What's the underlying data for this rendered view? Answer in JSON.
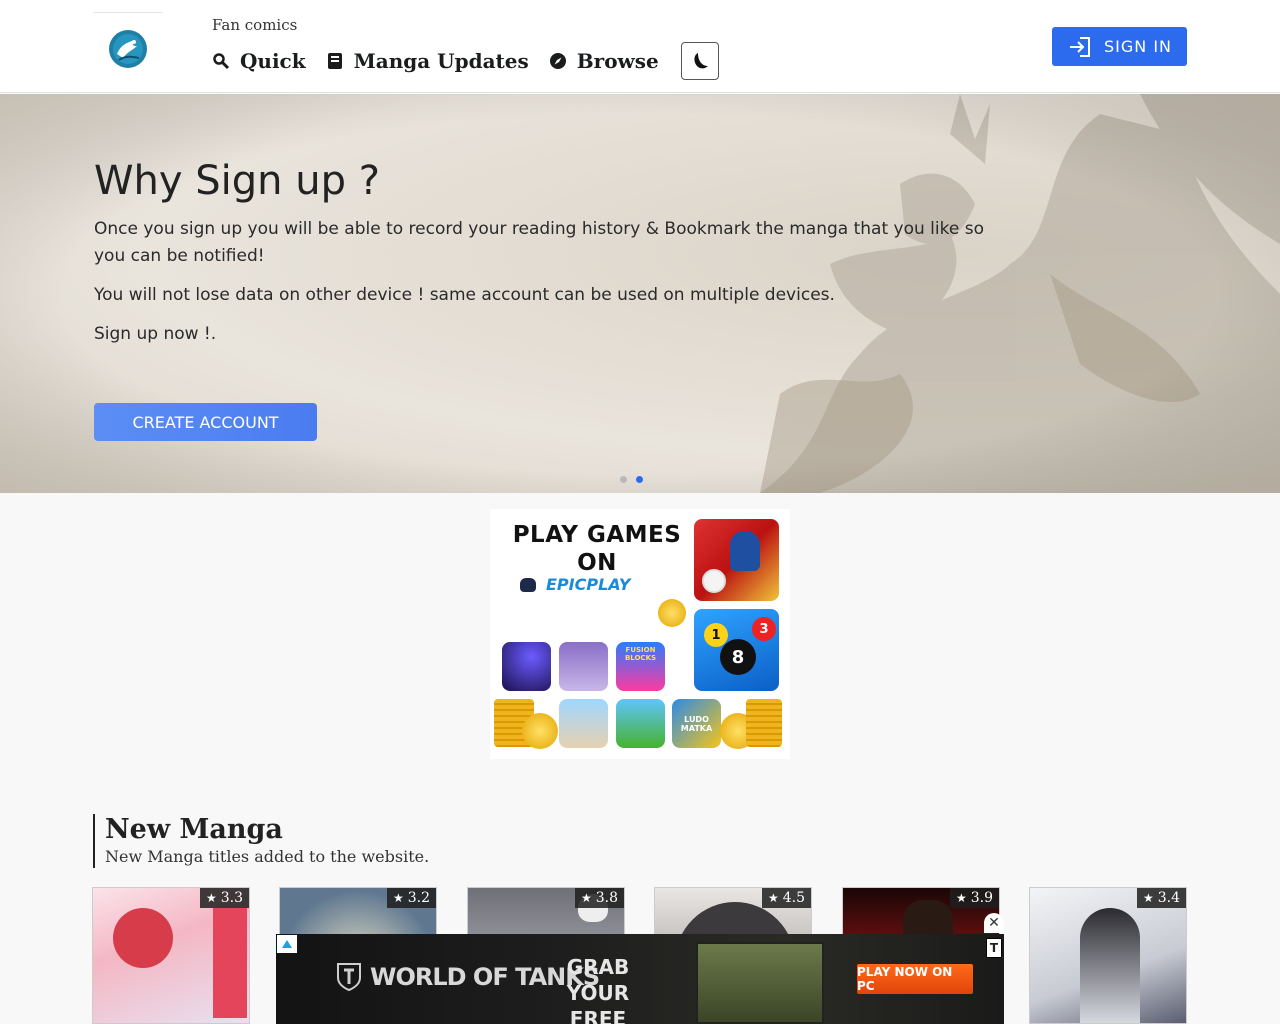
{
  "header": {
    "fan_label": "Fan comics",
    "nav": [
      {
        "label": "Quick",
        "icon": "search-icon"
      },
      {
        "label": "Manga Updates",
        "icon": "book-icon"
      },
      {
        "label": "Browse",
        "icon": "compass-icon"
      }
    ],
    "theme_toggle_icon": "moon-icon",
    "sign_in_label": "SIGN IN"
  },
  "hero": {
    "title": "Why Sign up ?",
    "paragraphs": [
      "Once you sign up you will be able to record your reading history & Bookmark the manga that you like so you can be notified!",
      "You will not lose data on other device ! same account can be used on multiple devices.",
      "Sign up now !."
    ],
    "cta_label": "CREATE ACCOUNT",
    "slide_count": 2,
    "active_slide": 2
  },
  "ad_banner": {
    "headline": "PLAY GAMES ON",
    "brand": "EPICPLAY",
    "tile_texts": [
      "FUSION BLOCKS",
      "LUDO MATKA",
      "1",
      "8",
      "3"
    ]
  },
  "new_manga": {
    "title": "New Manga",
    "subtitle": "New Manga titles added to the website.",
    "cards": [
      {
        "rating": "3.3"
      },
      {
        "rating": "3.2"
      },
      {
        "rating": "3.8"
      },
      {
        "rating": "4.5"
      },
      {
        "rating": "3.9"
      },
      {
        "rating": "3.4"
      }
    ]
  },
  "bottom_ad": {
    "brand": "WORLD OF TANKS",
    "headline_line1": "GRAB YOUR",
    "headline_line2": "FREE LOOT",
    "cta": "PLAY NOW ON PC",
    "close": "✕"
  },
  "colors": {
    "primary_blue": "#2c6bed",
    "cta_blue": "#5c8ef6",
    "active_dot": "#2c6bed",
    "inactive_dot": "#b9b9b9",
    "rating_bg": "#1e1e1e"
  }
}
